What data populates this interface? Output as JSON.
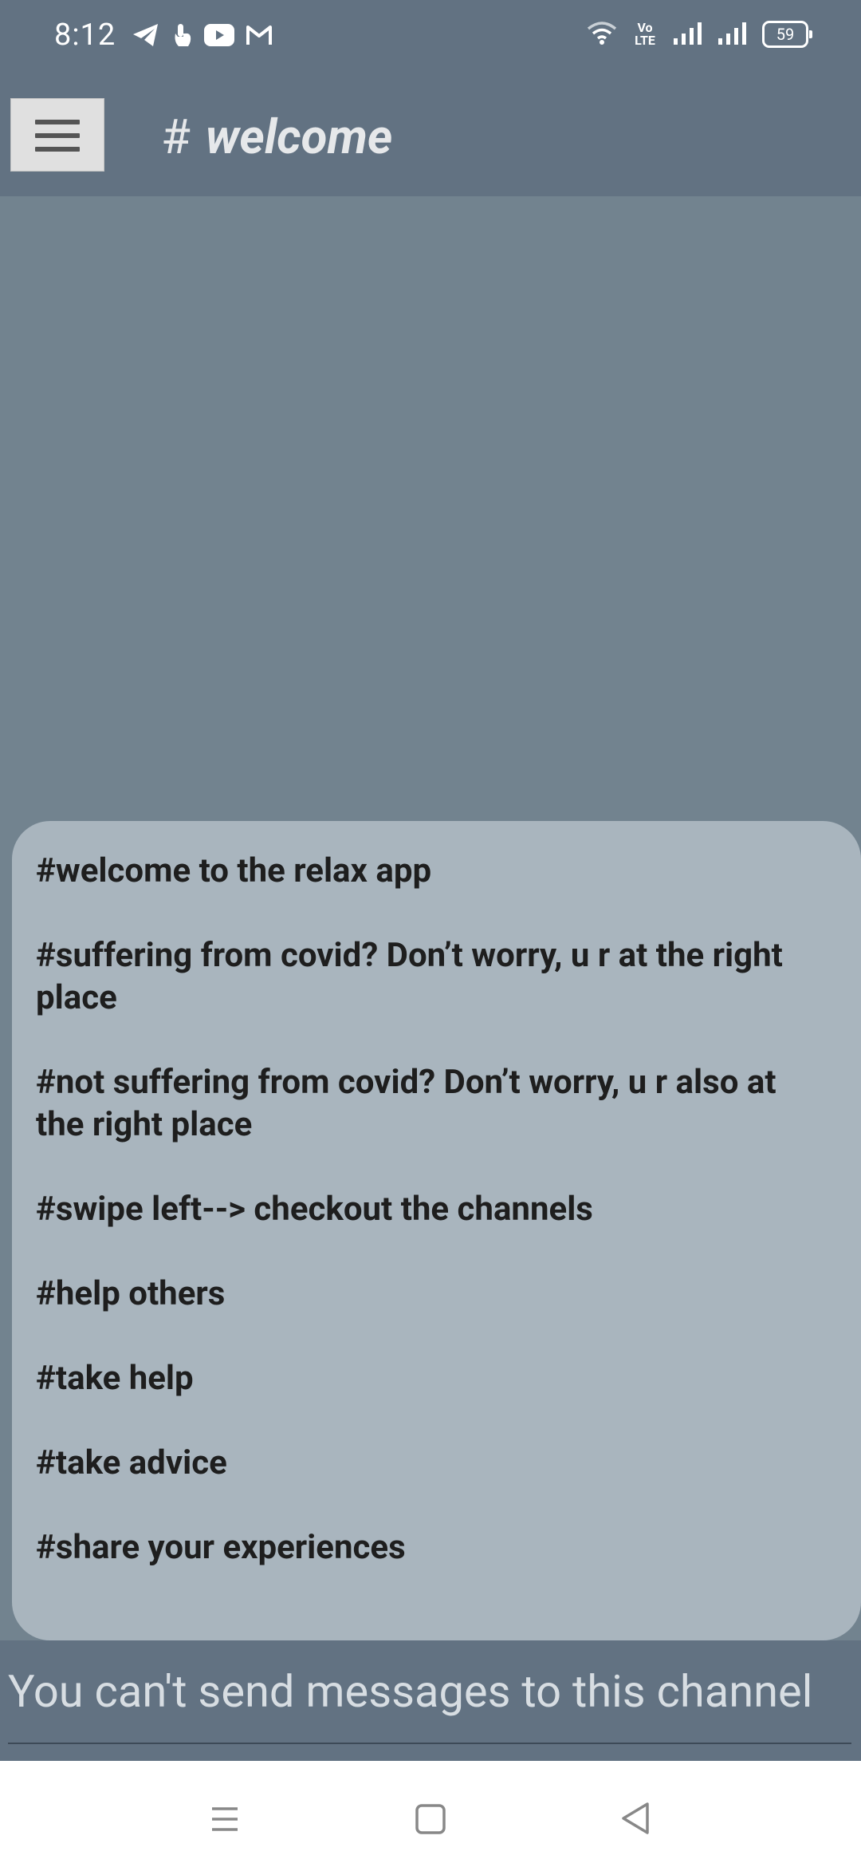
{
  "status_bar": {
    "time": "8:12",
    "left_icons": [
      "telegram-icon",
      "touch-icon",
      "youtube-icon",
      "gmail-icon"
    ],
    "volte_top": "Vo",
    "volte_bottom": "LTE",
    "battery_level": "59"
  },
  "header": {
    "channel_name": "welcome",
    "hash_symbol": "#"
  },
  "messages": [
    "#welcome to the relax app",
    "#suffering from covid? Don’t worry, u r at the right place",
    "#not suffering from covid? Don’t worry, u r also at the right place",
    "#swipe left--> checkout the channels",
    "#help others",
    "#take help",
    "#take advice",
    "#share your experiences"
  ],
  "composer": {
    "placeholder": "You can't send messages to this channel"
  },
  "nav_bar": {
    "buttons": [
      "recents-icon",
      "home-icon",
      "back-icon"
    ]
  },
  "colors": {
    "background": "#72838f",
    "header": "#627282",
    "card": "#a9b5be",
    "message_text": "#1e1e1e"
  }
}
